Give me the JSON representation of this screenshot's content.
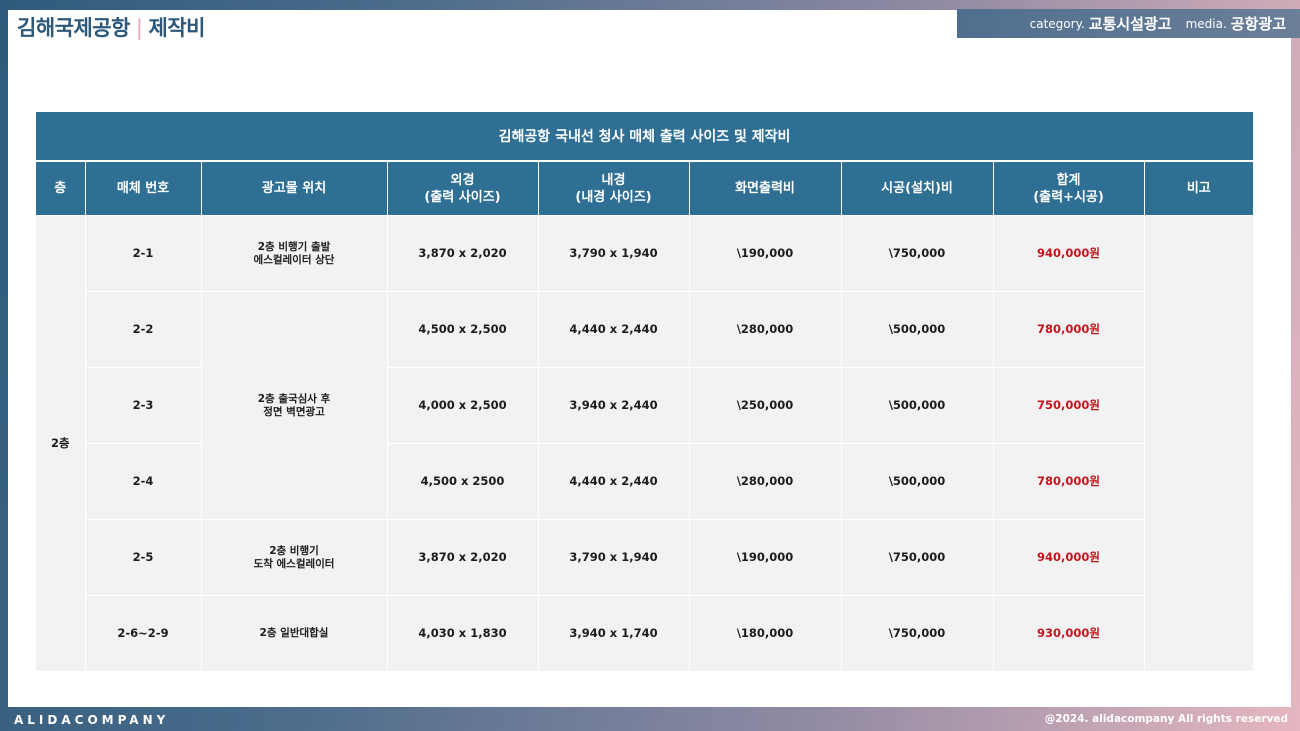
{
  "header": {
    "title_main": "김해국제공항",
    "title_sep": "|",
    "title_sub": "제작비",
    "category_key": "category.",
    "category_value": "교통시설광고",
    "media_key": "media.",
    "media_value": "공항광고"
  },
  "table": {
    "caption": "김해공항 국내선 청사 매체 출력 사이즈 및 제작비",
    "columns": [
      "층",
      "매체 번호",
      "광고물 위치",
      "외경\n(출력 사이즈)",
      "내경\n(내경 사이즈)",
      "화면출력비",
      "시공(설치)비",
      "합계\n(출력+시공)",
      "비고"
    ],
    "floor": "2층",
    "rows": [
      {
        "id": "2-1",
        "location": "2층 비행기 출발\n에스컬레이터 상단",
        "outer": "3,870 x 2,020",
        "inner": "3,790 x 1,940",
        "print": "\\190,000",
        "install": "\\750,000",
        "total": "940,000원"
      },
      {
        "id": "2-2",
        "location": "2층 출국심사 후\n정면 벽면광고",
        "outer": "4,500 x 2,500",
        "inner": "4,440 x 2,440",
        "print": "\\280,000",
        "install": "\\500,000",
        "total": "780,000원"
      },
      {
        "id": "2-3",
        "location": "",
        "outer": "4,000 x 2,500",
        "inner": "3,940 x 2,440",
        "print": "\\250,000",
        "install": "\\500,000",
        "total": "750,000원"
      },
      {
        "id": "2-4",
        "location": "",
        "outer": "4,500 x 2500",
        "inner": "4,440 x 2,440",
        "print": "\\280,000",
        "install": "\\500,000",
        "total": "780,000원"
      },
      {
        "id": "2-5",
        "location": "2층 비행기\n도착 에스컬레이터",
        "outer": "3,870 x 2,020",
        "inner": "3,790 x 1,940",
        "print": "\\190,000",
        "install": "\\750,000",
        "total": "940,000원"
      },
      {
        "id": "2-6~2-9",
        "location": "2층 일반대합실",
        "outer": "4,030 x 1,830",
        "inner": "3,940 x 1,740",
        "print": "\\180,000",
        "install": "\\750,000",
        "total": "930,000원"
      }
    ],
    "note": ""
  },
  "footer": {
    "brand": "ALIDACOMPANY",
    "copyright": "@2024. alidacompany All rights reserved"
  },
  "colors": {
    "header_blue": "#2f6f94",
    "title_blue": "#2d5879",
    "total_red": "#c6141c",
    "cell_gray": "#f2f2f2"
  }
}
